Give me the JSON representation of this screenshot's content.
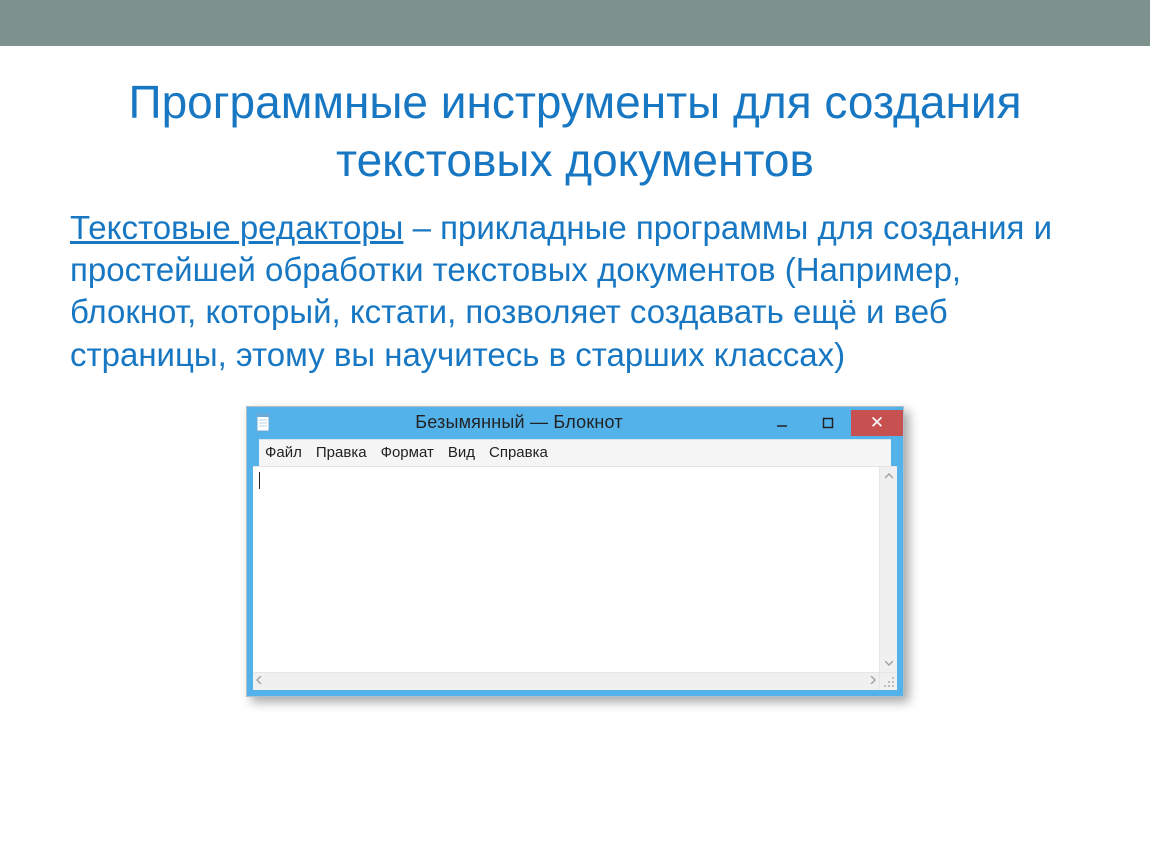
{
  "title": "Программные инструменты для создания текстовых документов",
  "paragraph": {
    "term": "Текстовые редакторы",
    "rest": " – прикладные программы для создания и простейшей обработки текстовых документов (Например, блокнот, который, кстати, позволяет создавать ещё и веб страницы, этому вы научитесь в старших классах)"
  },
  "notepad": {
    "window_title": "Безымянный — Блокнот",
    "menu": {
      "file": "Файл",
      "edit": "Правка",
      "format": "Формат",
      "view": "Вид",
      "help": "Справка"
    },
    "close_glyph": "✕"
  }
}
